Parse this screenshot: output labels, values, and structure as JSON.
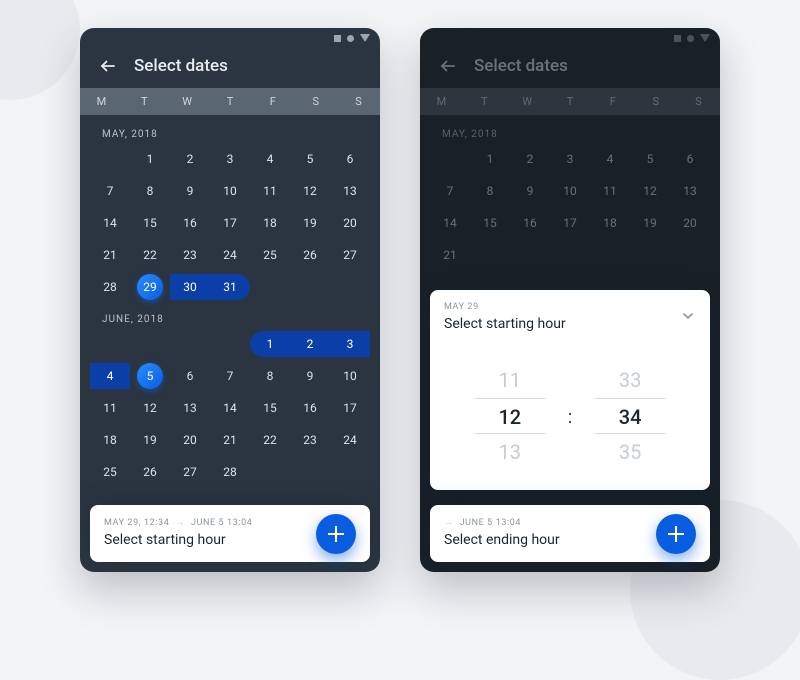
{
  "dow": [
    "M",
    "T",
    "W",
    "T",
    "F",
    "S",
    "S"
  ],
  "left": {
    "title": "Select dates",
    "month1_label": "MAY, 2018",
    "month2_label": "JUNE, 2018",
    "may": {
      "offset": 1,
      "days": 31,
      "sel_start": 29,
      "sel_end": 31,
      "cap": 29
    },
    "june": {
      "offset": 4,
      "days": 30,
      "partial": 28,
      "sel_start": 1,
      "sel_end": 5,
      "cap": 5
    },
    "footer_from": "MAY 29, 12:34",
    "footer_to": "JUNE 5 13:04",
    "footer_action": "Select starting hour"
  },
  "right": {
    "title": "Select dates",
    "month1_label": "MAY, 2018",
    "sheet_meta": "MAY 29",
    "sheet_title": "Select starting hour",
    "hour_prev": "11",
    "hour_sel": "12",
    "hour_next": "13",
    "min_prev": "33",
    "min_sel": "34",
    "min_next": "35",
    "footer_to": "JUNE 5 13:04",
    "footer_action": "Select ending hour"
  }
}
